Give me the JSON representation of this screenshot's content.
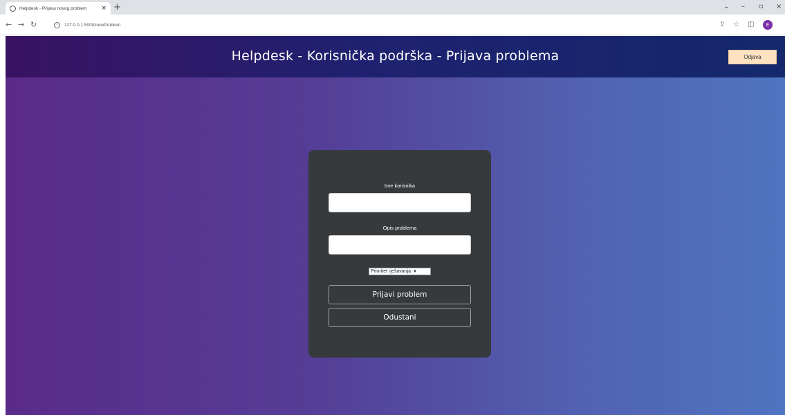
{
  "browser": {
    "tab_title": "Helpdesk - Prijava novog problem",
    "url": "127.0.0.1:5000/newProblem",
    "profile_initial": "E"
  },
  "header": {
    "title": "Helpdesk - Korisnička podrška - Prijava problema",
    "logout_label": "Odjava"
  },
  "form": {
    "username_label": "Ime korisnika",
    "username_value": "",
    "description_label": "Opis problema",
    "description_value": "",
    "priority_selected": "Prioritet rješavanja",
    "submit_label": "Prijavi problem",
    "cancel_label": "Odustani"
  },
  "colors": {
    "header_bg": "#1f2170",
    "card_bg": "#363a3d",
    "logout_bg": "#fde2c2",
    "gradient_left": "#5a2a8a",
    "gradient_right": "#4f74c0"
  }
}
